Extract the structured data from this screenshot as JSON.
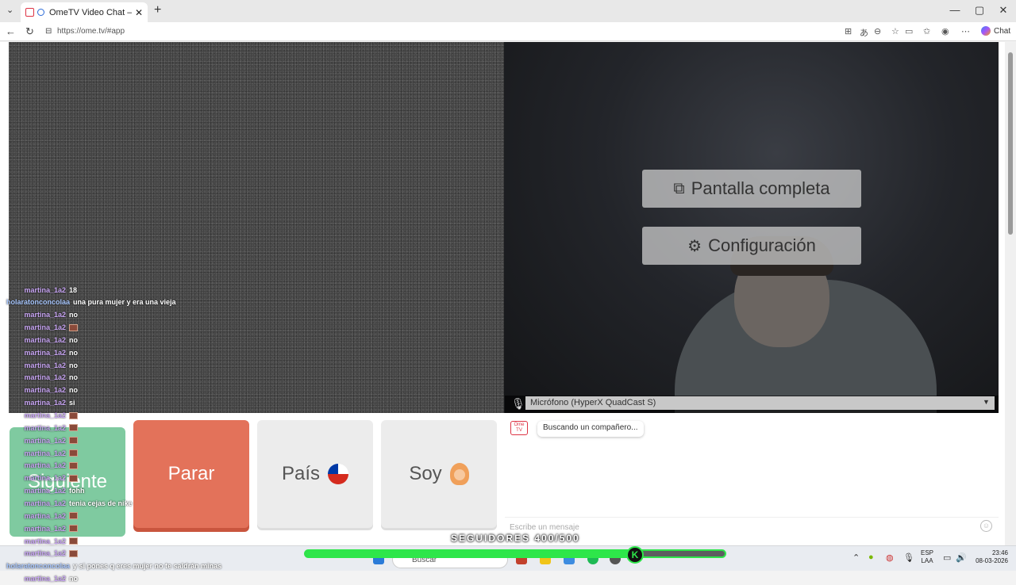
{
  "browser": {
    "tab_title": "OmeTV Video Chat — Omegle",
    "tab_close": "✕",
    "new_tab": "+",
    "url": "https://ome.tv/#app",
    "copilot_label": "Chat",
    "win_min": "—",
    "win_max": "▢",
    "win_close": "✕"
  },
  "overlay": {
    "fullscreen_label": "Pantalla completa",
    "config_label": "Configuración",
    "microphone": "Micrófono (HyperX QuadCast S)"
  },
  "controls": {
    "next_label": "Siguiente",
    "stop_label": "Parar",
    "country_label": "País",
    "iam_label": "Soy"
  },
  "chat": {
    "logo_text": "Ome TV",
    "searching": "Buscando un compañero...",
    "placeholder": "Escribe un mensaje"
  },
  "stream_chat": [
    {
      "user": "martina_1a2",
      "msg": "18",
      "emote": false
    },
    {
      "user": "holaratonconcolaa",
      "msg": "una pura mujer y era una vieja",
      "emote": false
    },
    {
      "user": "martina_1a2",
      "msg": "no",
      "emote": false
    },
    {
      "user": "martina_1a2",
      "msg": "",
      "emote": true
    },
    {
      "user": "martina_1a2",
      "msg": "no",
      "emote": false
    },
    {
      "user": "martina_1a2",
      "msg": "no",
      "emote": false
    },
    {
      "user": "martina_1a2",
      "msg": "no",
      "emote": false
    },
    {
      "user": "martina_1a2",
      "msg": "no",
      "emote": false
    },
    {
      "user": "martina_1a2",
      "msg": "no",
      "emote": false
    },
    {
      "user": "martina_1a2",
      "msg": "si",
      "emote": false
    },
    {
      "user": "martina_1a2",
      "msg": "",
      "emote": true
    },
    {
      "user": "martina_1a2",
      "msg": "",
      "emote": true
    },
    {
      "user": "martina_1a2",
      "msg": "",
      "emote": true
    },
    {
      "user": "martina_1a2",
      "msg": "",
      "emote": true
    },
    {
      "user": "martina_1a2",
      "msg": "",
      "emote": true
    },
    {
      "user": "martina_1a2",
      "msg": "",
      "emote": true
    },
    {
      "user": "martina_1a2",
      "msg": "fohh",
      "emote": false
    },
    {
      "user": "martina_1a2",
      "msg": "tenia cejas de nike",
      "emote": false
    },
    {
      "user": "martina_1a2",
      "msg": "",
      "emote": true
    },
    {
      "user": "martina_1a2",
      "msg": "",
      "emote": true
    },
    {
      "user": "martina_1a2",
      "msg": "",
      "emote": true
    },
    {
      "user": "martina_1a2",
      "msg": "",
      "emote": true
    },
    {
      "user": "holaratonconcolaa",
      "msg": "y si pones q eres mujer no te saldrán minas",
      "emote": false
    },
    {
      "user": "martina_1a2",
      "msg": "no",
      "emote": false
    }
  ],
  "stream_goal": {
    "label": "SEGUIDORES 400/500",
    "progress": 0.8,
    "badge": "K",
    "color": "#2ee64a"
  },
  "taskbar": {
    "search_placeholder": "Buscar",
    "lang_line1": "ESP",
    "lang_line2": "LAA",
    "time": "23:46",
    "date": "08-03-2026"
  }
}
